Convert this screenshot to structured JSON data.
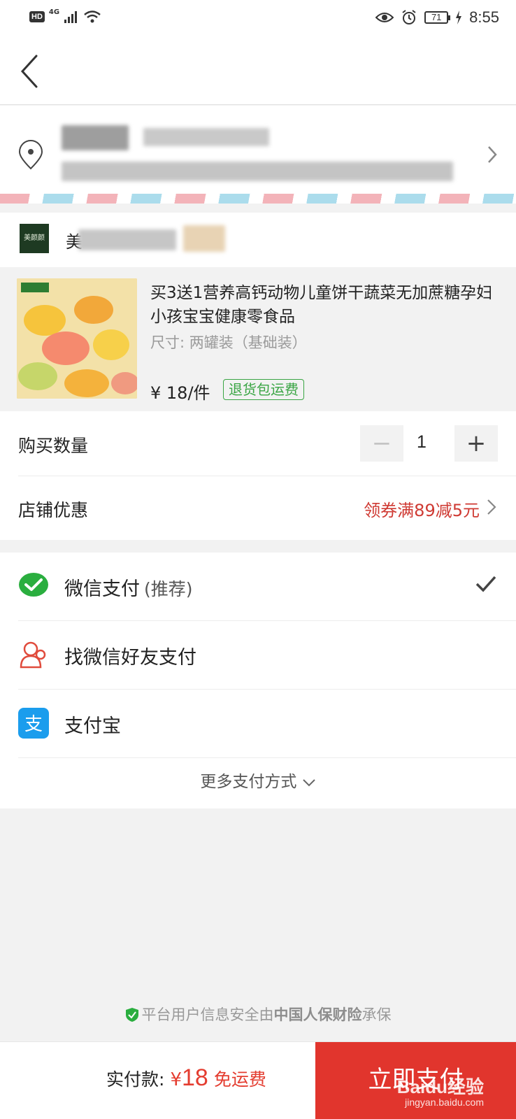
{
  "status_bar": {
    "hd": "HD",
    "network": "4G",
    "battery": "71",
    "time": "8:55"
  },
  "shop": {
    "name_visible": "美",
    "logo_text": "美颜颜"
  },
  "product": {
    "title": "买3送1营养高钙动物儿童饼干蔬菜无加蔗糖孕妇小孩宝宝健康零食品",
    "spec": "尺寸: 两罐装（基础装）",
    "price": "¥ 18/件",
    "return_badge": "退货包运费",
    "image_name": "animal-biscuits-photo"
  },
  "quantity": {
    "label": "购买数量",
    "value": "1",
    "minus": "−",
    "plus": "+"
  },
  "coupon": {
    "label": "店铺优惠",
    "value": "领券满89减5元"
  },
  "payments": {
    "methods": [
      {
        "label": "微信支付",
        "sub": "(推荐)",
        "icon": "wechat-pay-icon",
        "selected": true
      },
      {
        "label": "找微信好友支付",
        "sub": "",
        "icon": "friend-pay-icon",
        "selected": false
      },
      {
        "label": "支付宝",
        "sub": "",
        "icon": "alipay-icon",
        "selected": false
      }
    ],
    "more": "更多支付方式"
  },
  "insurance": {
    "prefix": "平台用户信息安全由",
    "company": "中国人保财险",
    "suffix": "承保"
  },
  "bottom": {
    "total_label": "实付款:",
    "currency": "¥",
    "amount": "18",
    "free_shipping": "免运费",
    "pay_button": "立即支付"
  },
  "watermark": {
    "line1": "Baidu经验",
    "line2": "jingyan.baidu.com"
  },
  "colors": {
    "accent_red": "#e1352d",
    "price_red": "#e43d30",
    "coupon_red": "#cf3a33",
    "badge_green": "#3aa544",
    "wechat_green": "#2aae3f",
    "alipay_blue": "#1b9ded"
  }
}
